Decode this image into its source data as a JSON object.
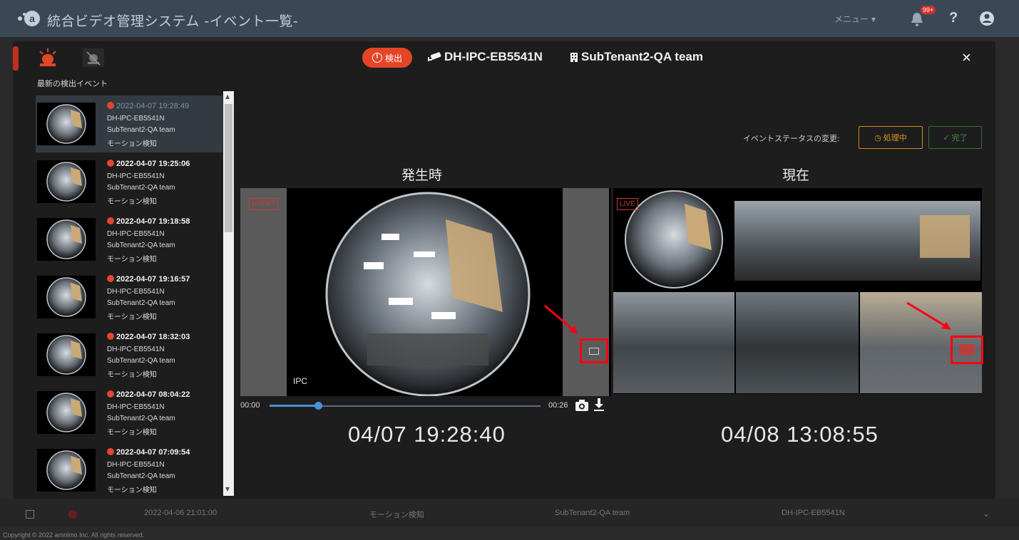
{
  "header": {
    "title": "統合ビデオ管理システム -イベント一覧-",
    "menu_label": "メニュー ▾",
    "notification_badge": "99+",
    "help_label": "?"
  },
  "sidebar": {
    "list_title": "最新の検出イベント",
    "events": [
      {
        "time": "2022-04-07 19:28:49",
        "camera": "DH-IPC-EB5541N",
        "tenant": "SubTenant2-QA team",
        "type": "モーション検知",
        "selected": true
      },
      {
        "time": "2022-04-07 19:25:06",
        "camera": "DH-IPC-EB5541N",
        "tenant": "SubTenant2-QA team",
        "type": "モーション検知"
      },
      {
        "time": "2022-04-07 19:18:58",
        "camera": "DH-IPC-EB5541N",
        "tenant": "SubTenant2-QA team",
        "type": "モーション検知"
      },
      {
        "time": "2022-04-07 19:16:57",
        "camera": "DH-IPC-EB5541N",
        "tenant": "SubTenant2-QA team",
        "type": "モーション検知"
      },
      {
        "time": "2022-04-07 18:32:03",
        "camera": "DH-IPC-EB5541N",
        "tenant": "SubTenant2-QA team",
        "type": "モーション検知"
      },
      {
        "time": "2022-04-07 08:04:22",
        "camera": "DH-IPC-EB5541N",
        "tenant": "SubTenant2-QA team",
        "type": "モーション検知"
      },
      {
        "time": "2022-04-07 07:09:54",
        "camera": "DH-IPC-EB5541N",
        "tenant": "SubTenant2-QA team",
        "type": "モーション検知"
      }
    ]
  },
  "detail": {
    "detect_label": "検出",
    "camera_name": "DH-IPC-EB5541N",
    "tenant_name": "SubTenant2-QA team",
    "close_label": "×",
    "status_change_label": "イベントステータスの変更:",
    "processing_label": "処理中",
    "done_label": "完了",
    "occurrence_heading": "発生時",
    "current_heading": "現在",
    "event_tag": "EVENT",
    "live_tag": "LIVE",
    "ipc_label": "IPC",
    "playback_start": "00:00",
    "playback_end": "00:26",
    "playback_progress": 0.18,
    "occurrence_time": "04/07 19:28:40",
    "current_time": "04/08 13:08:55"
  },
  "background_row": {
    "time": "2022-04-06 21:01:00",
    "type": "モーション検知",
    "tenant": "SubTenant2-QA team",
    "camera": "DH-IPC-EB5541N"
  },
  "footer": {
    "copyright": "Copyright © 2022 amnimo Inc. All rights reserved."
  },
  "colors": {
    "accent_red": "#e54527",
    "processing_orange": "#e0951f",
    "done_green": "#4f8b4f",
    "topbar": "#3a4856"
  }
}
